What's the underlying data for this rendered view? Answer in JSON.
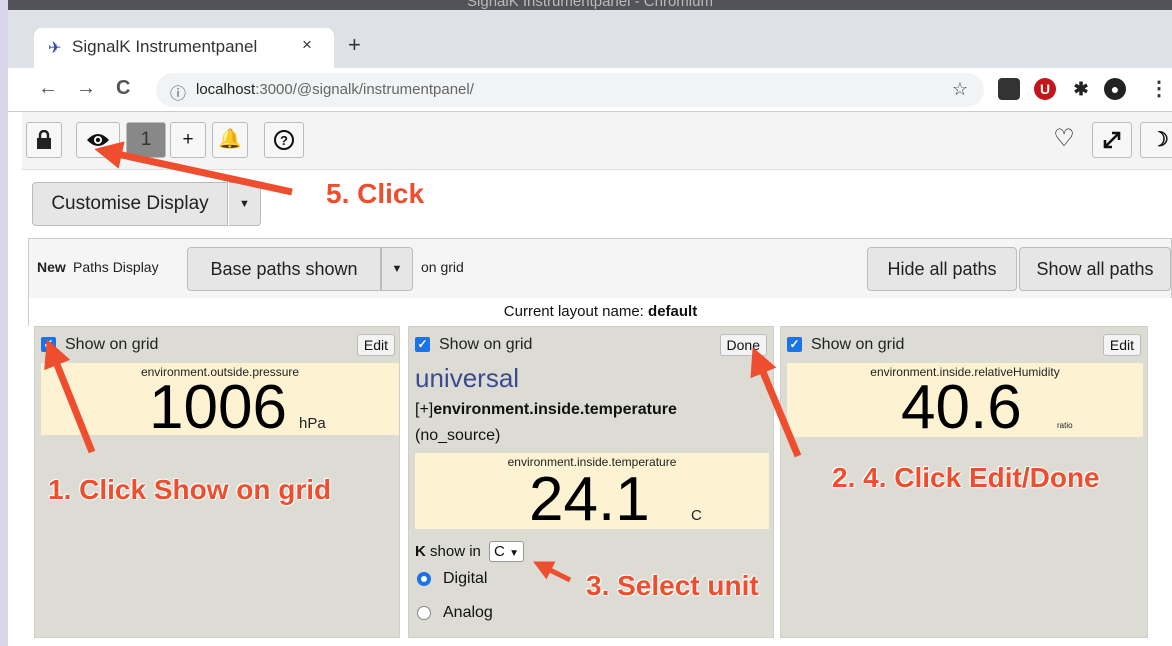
{
  "window": {
    "title": "SignalK Instrumentpanel - Chromium"
  },
  "browser": {
    "tab_title": "SignalK Instrumentpanel",
    "tab_close": "×",
    "new_tab": "+",
    "url_host": "localhost",
    "url_path": ":3000/@signalk/instrumentpanel/"
  },
  "toolbar": {
    "page_number": "1",
    "add_label": "+",
    "help_label": "?"
  },
  "customise": {
    "label": "Customise Display"
  },
  "paths_bar": {
    "new_label": "New",
    "paths_display_label": "Paths Display",
    "base_paths_select": "Base paths shown",
    "on_grid_label": "on grid",
    "hide_all": "Hide all paths",
    "show_all": "Show all paths"
  },
  "layout": {
    "prefix": "Current layout name:",
    "name": "default"
  },
  "panels": [
    {
      "show_label": "Show on grid",
      "edit_label": "Edit",
      "path": "environment.outside.pressure",
      "value": "1006",
      "unit": "hPa"
    },
    {
      "show_label": "Show on grid",
      "edit_label": "Done",
      "title": "universal",
      "path_prefix": "[+]",
      "path_full": "environment.inside.temperature",
      "source": "(no_source)",
      "path": "environment.inside.temperature",
      "value": "24.1",
      "unit": "C",
      "unit_row_k": "K",
      "unit_row_text": "show in",
      "unit_selected": "C",
      "display_options": [
        "Digital",
        "Analog"
      ],
      "display_selected": "Digital"
    },
    {
      "show_label": "Show on grid",
      "edit_label": "Edit",
      "path": "environment.inside.relativeHumidity",
      "value": "40.6",
      "unit": "ratio"
    }
  ],
  "annotations": {
    "step1": "1. Click Show on grid",
    "step2": "2. 4. Click Edit/Done",
    "step3": "3. Select unit",
    "step5": "5. Click",
    "color": "#ee4e2e"
  },
  "colors": {
    "gauge_bg": "#fdf3d3",
    "panel_bg": "#dcdcd4",
    "checkbox": "#1a73e8",
    "universal_text": "#3d4a90"
  }
}
